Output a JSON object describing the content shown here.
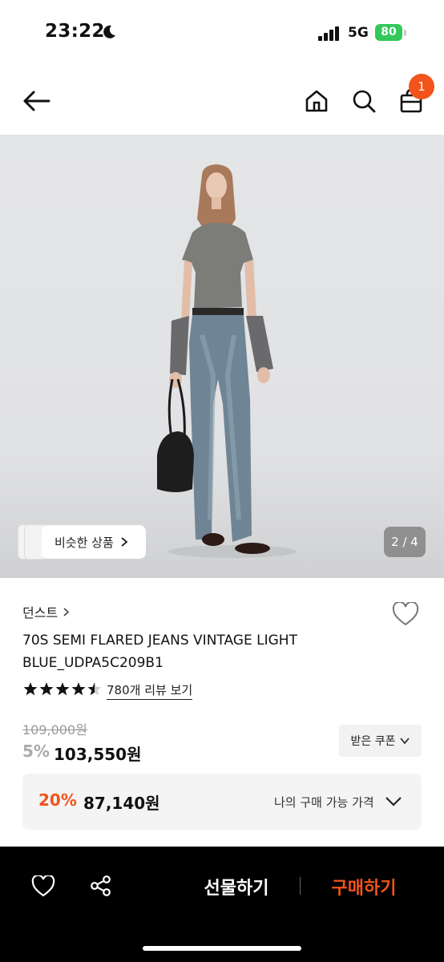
{
  "status_bar": {
    "time": "23:22",
    "network": "5G",
    "battery": "80"
  },
  "nav": {
    "cart_count": "1"
  },
  "gallery": {
    "similar_label": "비슷한 상품",
    "pager": "2 / 4"
  },
  "product": {
    "brand": "던스트",
    "name": "70S SEMI FLARED JEANS VINTAGE LIGHT BLUE_UDPA5C209B1",
    "rating": 4.5,
    "review_link": "780개 리뷰 보기",
    "original_price": "109,000원",
    "discount_rate": "5%",
    "sale_price": "103,550원",
    "coupon_label": "받은 쿠폰"
  },
  "my_price": {
    "rate": "20%",
    "price": "87,140원",
    "label": "나의 구매 가능 가격"
  },
  "bottom_bar": {
    "gift_label": "선물하기",
    "buy_label": "구매하기"
  },
  "colors": {
    "accent": "#f2541b",
    "battery": "#34c759"
  }
}
